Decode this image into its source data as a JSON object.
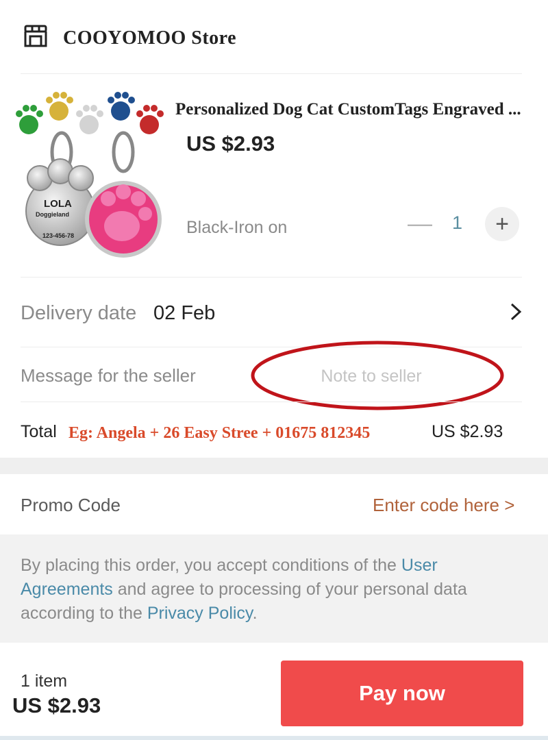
{
  "store": {
    "name": "COOYOMOO  Store",
    "icon": "store-icon"
  },
  "product": {
    "title": "Personalized Dog Cat CustomTags Engraved ...",
    "price": "US $2.93",
    "variant": "Black-Iron on",
    "quantity": "1",
    "image_tag_text": {
      "name": "LOLA",
      "line2": "Doggieland",
      "line3": "123-456-78"
    },
    "colors": {
      "green": "#2e9e3a",
      "gold": "#d6b23a",
      "silver": "#cfcfcf",
      "blue": "#1f4f8f",
      "red": "#c42b2b",
      "pink": "#e83c80"
    }
  },
  "quantity_controls": {
    "minus": "—",
    "plus": "+"
  },
  "delivery": {
    "label": "Delivery date",
    "date": "02 Feb",
    "chevron": "chevron-right-icon"
  },
  "message": {
    "label": "Message for the seller",
    "placeholder": "Note to seller"
  },
  "total": {
    "label": "Total",
    "example": "Eg: Angela + 26 Easy Stree + 01675 812345",
    "value": "US $2.93"
  },
  "promo": {
    "label": "Promo Code",
    "link": "Enter code here >"
  },
  "terms": {
    "prefix": "By placing this order, you accept conditions of the ",
    "link1": "User Agreements",
    "middle": " and agree to processing of your personal data according to the ",
    "link2": "Privacy Policy",
    "suffix": "."
  },
  "footer": {
    "item_count": "1 item",
    "total": "US $2.93",
    "pay_label": "Pay now"
  },
  "theme": {
    "accent": "#f04b4b",
    "link": "#4a8aa8",
    "promo": "#b0623a",
    "annotation": "#d94a2a",
    "circle": "#c0141a"
  }
}
